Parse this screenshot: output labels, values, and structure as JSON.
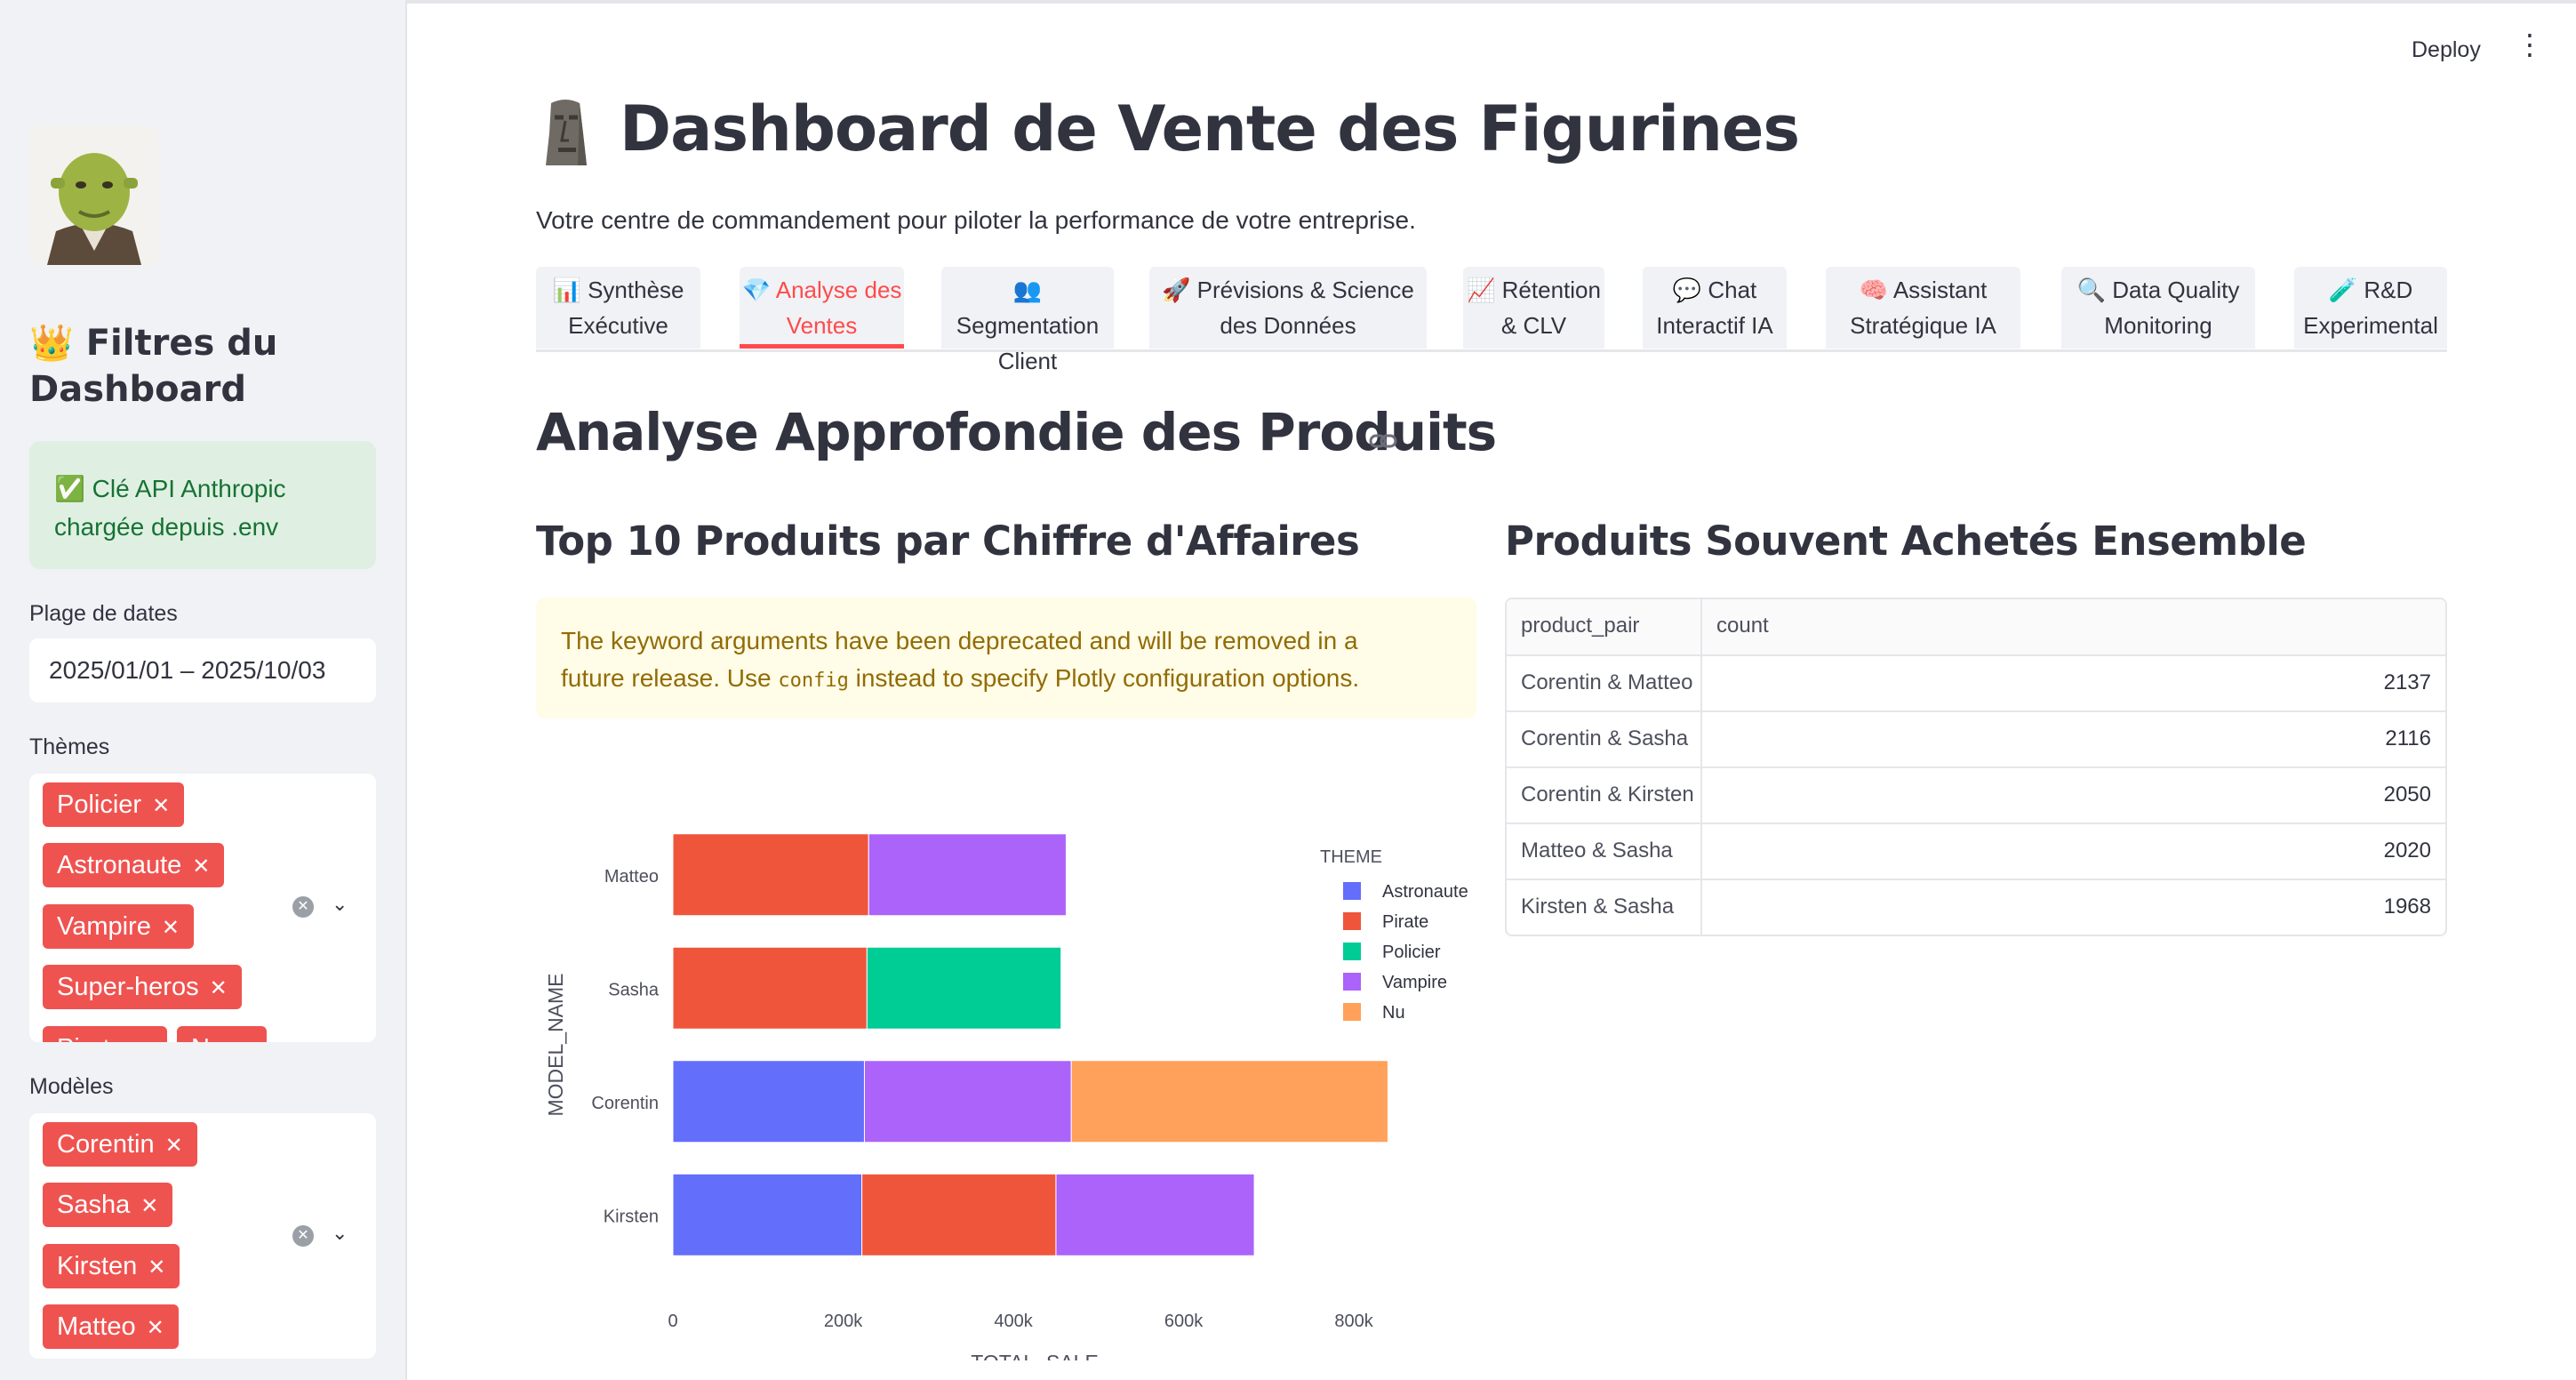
{
  "sidebar": {
    "title": "👑 Filtres du Dashboard",
    "api_status": "✅ Clé API Anthropic chargée depuis .env",
    "date_label": "Plage de dates",
    "date_value": "2025/01/01 – 2025/10/03",
    "themes_label": "Thèmes",
    "themes": [
      "Policier",
      "Astronaute",
      "Vampire",
      "Super-heros",
      "Pirate",
      "Nu"
    ],
    "models_label": "Modèles",
    "models": [
      "Corentin",
      "Sasha",
      "Kirsten",
      "Matteo"
    ]
  },
  "header": {
    "deploy_label": "Deploy",
    "menu_icon": "⋮"
  },
  "main": {
    "title": "Dashboard de Vente des Figurines",
    "title_icon": "moai-icon",
    "subtitle": "Votre centre de commandement pour piloter la performance de votre entreprise.",
    "tabs": [
      {
        "line1": "📊 Synthèse",
        "line2": "Exécutive"
      },
      {
        "line1": "💎 Analyse des",
        "line2": "Ventes"
      },
      {
        "line1": "👥 Segmentation",
        "line2": "Client"
      },
      {
        "line1": "🚀 Prévisions & Science",
        "line2": "des Données"
      },
      {
        "line1": "📈 Rétention",
        "line2": "& CLV"
      },
      {
        "line1": "💬 Chat",
        "line2": "Interactif IA"
      },
      {
        "line1": "🧠 Assistant",
        "line2": "Stratégique IA"
      },
      {
        "line1": "🔍 Data Quality",
        "line2": "Monitoring"
      },
      {
        "line1": "🧪 R&D",
        "line2": "Experimental"
      }
    ],
    "active_tab": 1,
    "section_title": "Analyse Approfondie des Produits",
    "left_title": "Top 10 Produits par Chiffre d'Affaires",
    "right_title": "Produits Souvent Achetés Ensemble",
    "warning_text_1": "The keyword arguments have been deprecated and will be removed in a",
    "warning_text_2a": "future release. Use ",
    "warning_code": "config",
    "warning_text_2b": " instead to specify Plotly configuration options."
  },
  "table": {
    "headers": [
      "product_pair",
      "count"
    ],
    "rows": [
      {
        "pair": "Corentin & Matteo",
        "count": "2137"
      },
      {
        "pair": "Corentin & Sasha",
        "count": "2116"
      },
      {
        "pair": "Corentin & Kirsten",
        "count": "2050"
      },
      {
        "pair": "Matteo & Sasha",
        "count": "2020"
      },
      {
        "pair": "Kirsten & Sasha",
        "count": "1968"
      }
    ]
  },
  "chart_data": {
    "type": "bar",
    "orientation": "horizontal",
    "barmode": "stack",
    "categories": [
      "Matteo",
      "Sasha",
      "Corentin",
      "Kirsten"
    ],
    "series": [
      {
        "name": "Astronaute",
        "color": "#636efa",
        "values": [
          0,
          0,
          225000,
          222000
        ]
      },
      {
        "name": "Pirate",
        "color": "#ef553b",
        "values": [
          230000,
          228000,
          0,
          228000
        ]
      },
      {
        "name": "Policier",
        "color": "#00cc96",
        "values": [
          0,
          228000,
          0,
          0
        ]
      },
      {
        "name": "Vampire",
        "color": "#ab63fa",
        "values": [
          232000,
          0,
          243000,
          233000
        ]
      },
      {
        "name": "Nu",
        "color": "#ffa15a",
        "values": [
          0,
          0,
          372000,
          0
        ]
      }
    ],
    "xlabel": "TOTAL_SALE",
    "ylabel": "MODEL_NAME",
    "legend_title": "THEME",
    "xlim": [
      0,
      850000
    ],
    "xticks": [
      0,
      200000,
      400000,
      600000,
      800000
    ],
    "xtick_labels": [
      "0",
      "200k",
      "400k",
      "600k",
      "800k"
    ],
    "legend_placement": "right"
  }
}
